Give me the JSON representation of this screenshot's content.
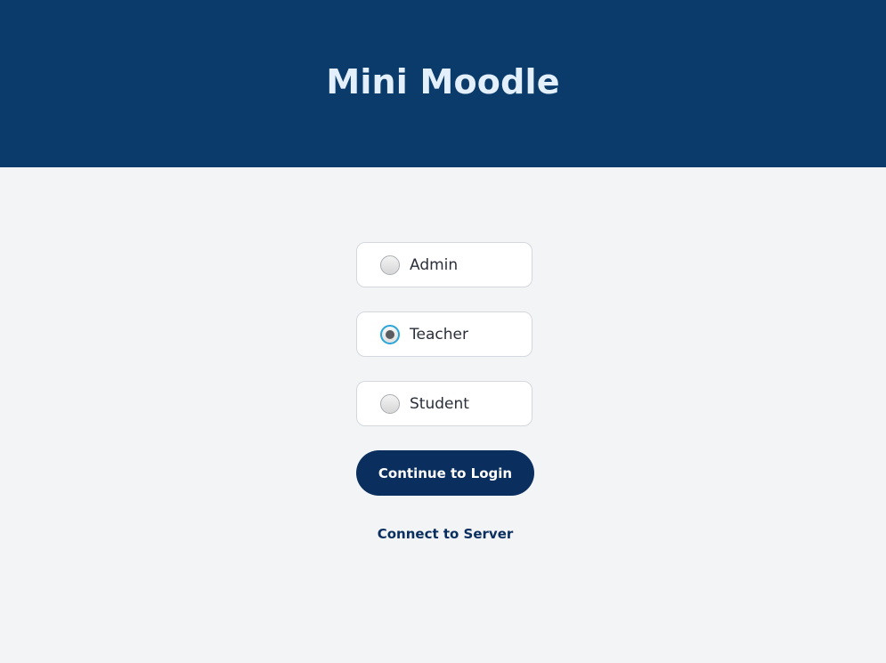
{
  "header": {
    "title": "Mini Moodle"
  },
  "roles": [
    {
      "label": "Admin",
      "selected": false
    },
    {
      "label": "Teacher",
      "selected": true
    },
    {
      "label": "Student",
      "selected": false
    }
  ],
  "actions": {
    "continue_label": "Continue to Login",
    "server_link_label": "Connect to Server"
  },
  "colors": {
    "header_bg": "#0a3b6a",
    "header_text": "#e3effa",
    "page_bg": "#f3f4f6",
    "primary": "#0a2f5e",
    "radio_focus": "#2aa6d9"
  }
}
